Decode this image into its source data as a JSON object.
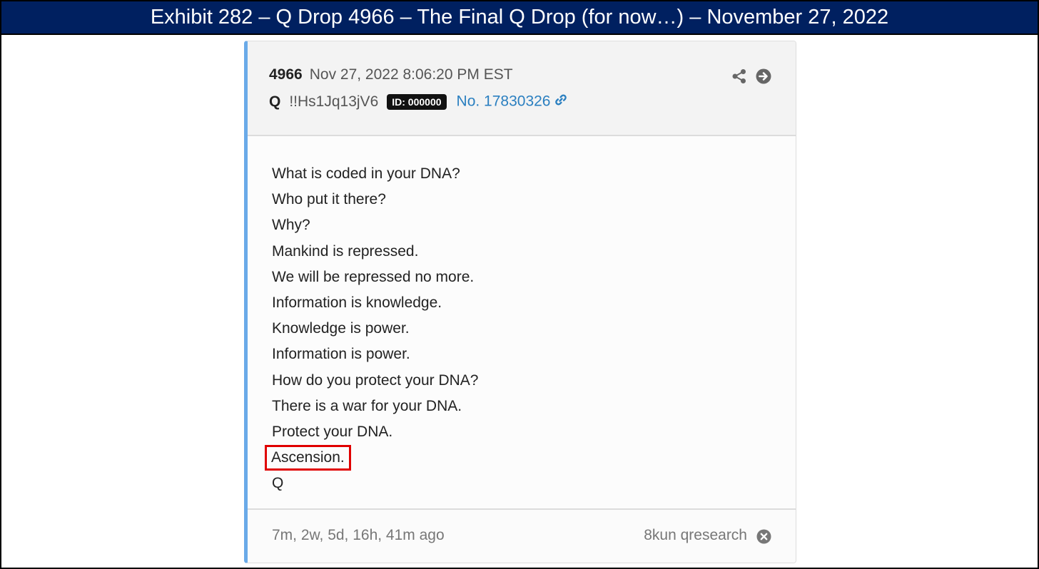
{
  "exhibit": {
    "title": "Exhibit 282 – Q Drop 4966 – The Final Q Drop (for now…) – November 27, 2022"
  },
  "post": {
    "number": "4966",
    "timestamp": "Nov 27, 2022 8:06:20 PM EST",
    "author": "Q",
    "tripcode": "!!Hs1Jq13jV6",
    "id_badge": "ID: 000000",
    "link_label": "No. 17830326",
    "header_icons": [
      "share-icon",
      "arrow-circle-right-icon"
    ],
    "lines": [
      "What is coded in your DNA?",
      "Who put it there?",
      "Why?",
      "Mankind is repressed.",
      "We will be repressed no more.",
      "Information is knowledge.",
      "Knowledge is power.",
      "Information is power.",
      "How do you protect your DNA?",
      "There is a war for your DNA.",
      "Protect your DNA.",
      "Ascension.",
      "Q"
    ],
    "highlighted_line_index": 11,
    "elapsed": "7m, 2w, 5d, 16h, 41m ago",
    "source": "8kun qresearch"
  },
  "colors": {
    "title_bar": "#002060",
    "accent_border": "#6aaae8",
    "link": "#2a7fc0",
    "highlight_box": "#e00000"
  }
}
